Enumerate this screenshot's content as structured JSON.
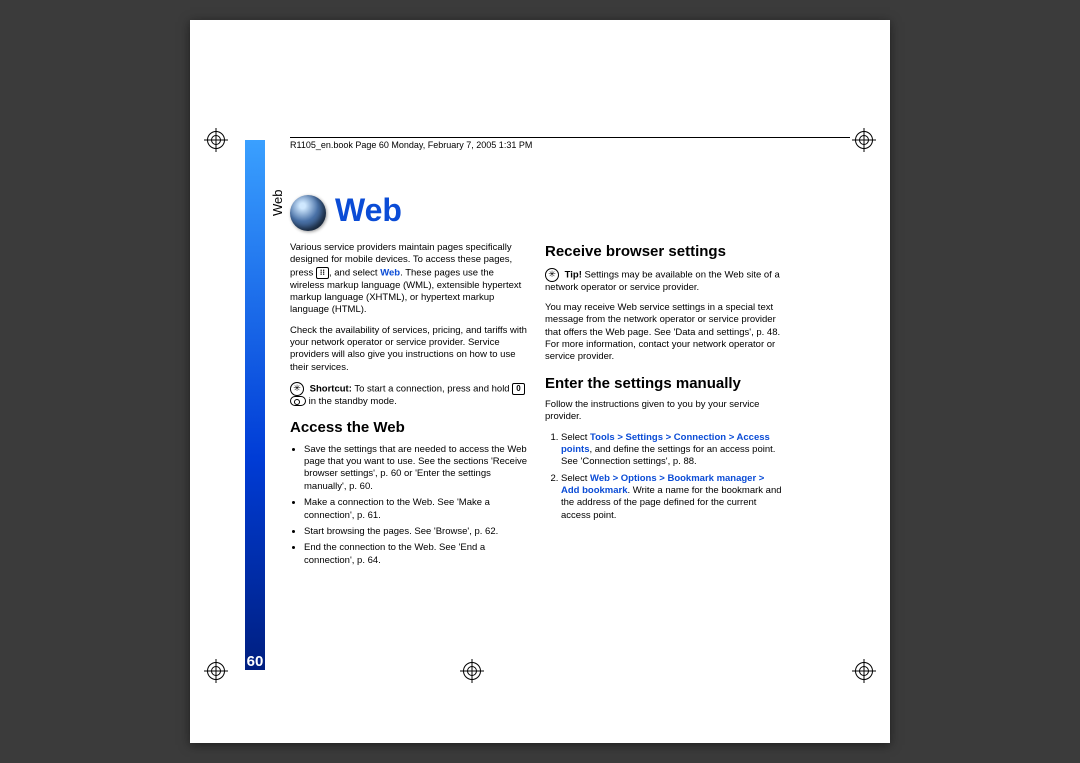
{
  "header_text": "R1105_en.book  Page 60  Monday, February 7, 2005  1:31 PM",
  "side_label": "Web",
  "page_number": "60",
  "title": "Web",
  "intro_a": "Various service providers maintain pages specifically designed for mobile devices. To access these pages, press ",
  "intro_link1": "Web",
  "intro_b": ", and select ",
  "intro_c": ". These pages use the wireless markup language (WML), extensible hypertext markup language (XHTML), or hypertext markup language (HTML).",
  "para2": "Check the availability of services, pricing, and tariffs with your network operator or service provider. Service providers will also give you instructions on how to use their services.",
  "shortcut_label": "Shortcut:",
  "shortcut_a": " To start a connection, press and hold ",
  "shortcut_b": " in the standby mode.",
  "h_access": "Access the Web",
  "bul": [
    "Save the settings that are needed to access the Web page that you want to use. See the sections 'Receive browser settings', p. 60 or 'Enter the settings manually', p. 60.",
    "Make a connection to the Web. See 'Make a connection', p. 61.",
    "Start browsing the pages. See 'Browse', p. 62.",
    "End the connection to the Web. See 'End a connection', p. 64."
  ],
  "h_receive": "Receive browser settings",
  "tip_label": "Tip!",
  "tip_text": " Settings may be available on the Web site of a network operator or service provider.",
  "para_receive": "You may receive Web service settings in a special text message from the network operator or service provider that offers the Web page. See 'Data and settings', p. 48. For more information, contact your network operator or service provider.",
  "h_enter": "Enter the settings manually",
  "para_enter": "Follow the instructions given to you by your service provider.",
  "step1_a": "Select ",
  "step1_link": "Tools > Settings > Connection > Access points",
  "step1_b": ", and define the settings for an access point. See 'Connection settings', p. 88.",
  "step2_a": "Select ",
  "step2_link": "Web > Options > Bookmark manager > Add bookmark",
  "step2_b": ". Write a name for the bookmark and the address of the page defined for the current access point."
}
